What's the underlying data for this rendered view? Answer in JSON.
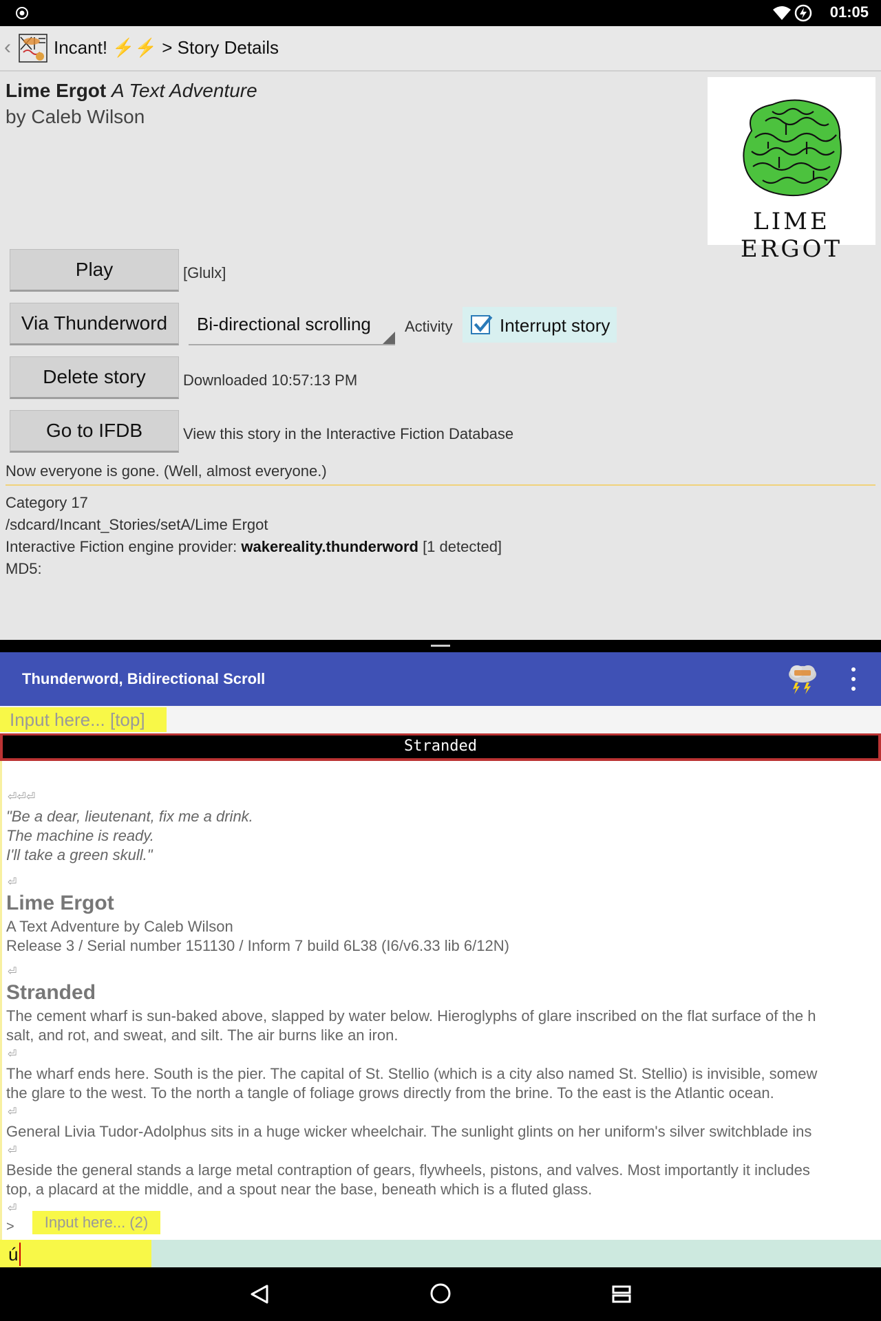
{
  "statusbar": {
    "time": "01:05"
  },
  "actionbar": {
    "app_name": "Incant! ⚡⚡",
    "breadcrumb": "> Story Details"
  },
  "story": {
    "title": "Lime Ergot",
    "subtitle": "A Text Adventure",
    "author": "by Caleb Wilson",
    "cover_caption": "LIME ERGOT",
    "blurb": "Now everyone is gone. (Well, almost everyone.)"
  },
  "actions": {
    "play": "Play",
    "play_format": "[Glulx]",
    "via_thunderword": "Via Thunderword",
    "scroll_mode": "Bi-directional scrolling",
    "activity_label": "Activity",
    "interrupt_label": "Interrupt story",
    "interrupt_checked": true,
    "delete": "Delete story",
    "downloaded": "Downloaded 10:57:13 PM",
    "ifdb": "Go to IFDB",
    "ifdb_desc": "View this story in the Interactive Fiction Database"
  },
  "meta": {
    "category": "Category 17",
    "path": "/sdcard/Incant_Stories/setA/Lime Ergot",
    "engine_prefix": "Interactive Fiction engine provider: ",
    "engine_name": "wakereality.thunderword",
    "engine_suffix": " [1 detected]",
    "md5": "MD5:"
  },
  "thunderword": {
    "toolbar_title": "Thunderword, Bidirectional Scroll",
    "top_input_placeholder": "Input here... [top]",
    "status_line": "Stranded",
    "inline_input_placeholder": "Input here... (2)",
    "prompt": ">",
    "bottom_input_value": "ú"
  },
  "transcript": {
    "returns_3": "⏎⏎⏎",
    "ret": "⏎",
    "epigraph1": "\"Be a dear, lieutenant, fix me a drink.",
    "epigraph2": "The machine is ready.",
    "epigraph3": "I'll take a green skull.\"",
    "game_title": "Lime Ergot",
    "byline": "A Text Adventure by Caleb Wilson",
    "release": "Release 3 / Serial number 151130 / Inform 7 build 6L38 (I6/v6.33 lib 6/12N)",
    "room": "Stranded",
    "p1a": "The cement wharf is sun-baked above, slapped by water below. Hieroglyphs of glare inscribed on the flat surface of the h",
    "p1b": "salt, and rot, and sweat, and silt. The air burns like an iron.",
    "p2a": "The wharf ends here. South is the pier. The capital of St. Stellio (which is a city also named St. Stellio) is invisible, somew",
    "p2b": "the glare to the west. To the north a tangle of foliage grows directly from the brine. To the east is the Atlantic ocean.",
    "p3": "General Livia Tudor-Adolphus sits in a huge wicker wheelchair. The sunlight glints on her uniform's silver switchblade ins",
    "p4a": "Beside the general stands a large metal contraption of gears, flywheels, pistons, and valves. Most importantly it includes",
    "p4b": "top, a placard at the middle, and a spout near the base, beneath which is a fluted glass."
  }
}
